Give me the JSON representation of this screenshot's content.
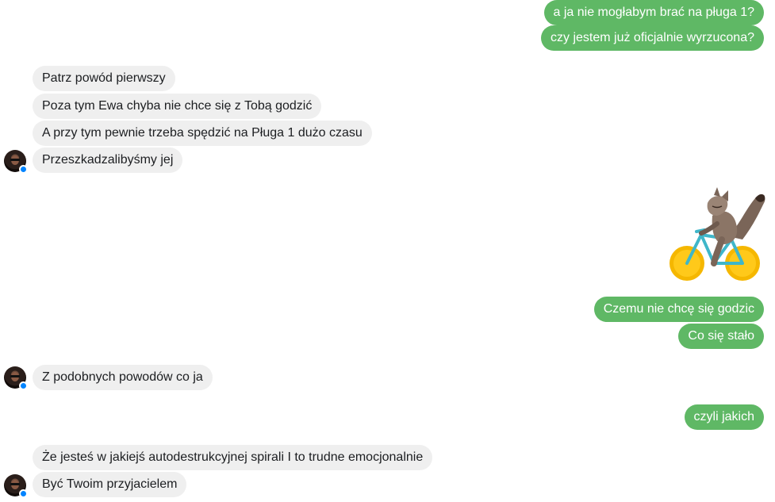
{
  "messages": {
    "m1": "a ja nie mogłabym brać na pługa 1?",
    "m2": "czy jestem już oficjalnie wyrzucona?",
    "m3": "Patrz powód pierwszy",
    "m4": "Poza tym Ewa chyba nie chce się z Tobą godzić",
    "m5": "A przy tym pewnie trzeba spędzić na Pługa 1 dużo czasu",
    "m6": "Przeszkadzalibyśmy jej",
    "m7": "Czemu nie chcę się godzic",
    "m8": "Co się stało",
    "m9": "Z podobnych powodów co ja",
    "m10": "czyli jakich",
    "m11": "Że jesteś w jakiejś autodestrukcyjnej spirali I to trudne emocjonalnie",
    "m12": "Być Twoim przyjacielem"
  },
  "colors": {
    "outgoing_bubble": "#5fb865",
    "incoming_bubble": "#efefef",
    "messenger_badge": "#0084ff"
  },
  "sticker": "fox-riding-bicycle-sticker"
}
